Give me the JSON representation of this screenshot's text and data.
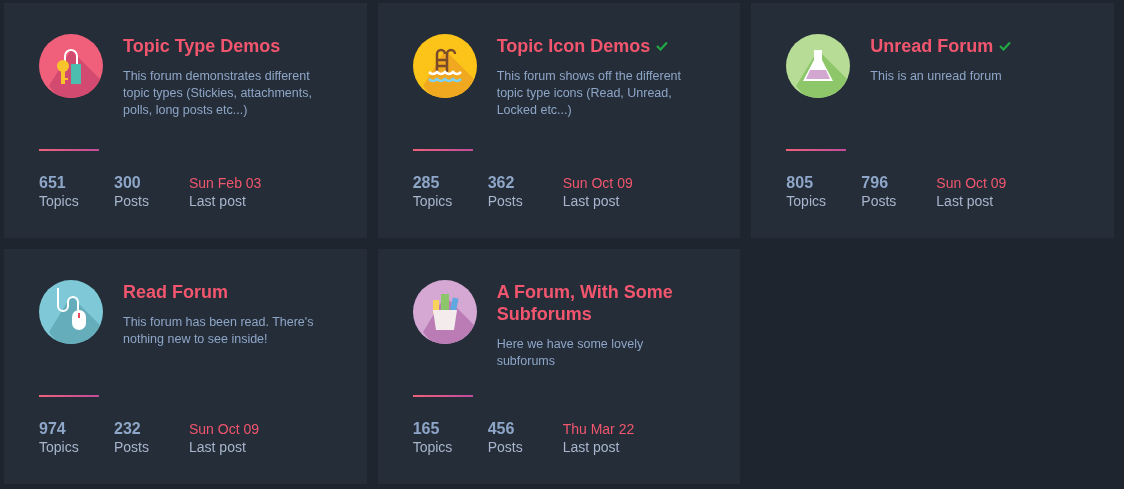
{
  "forums": [
    {
      "title": "Topic Type Demos",
      "checked": false,
      "description": "This forum demonstrates different topic types (Stickies, attachments, polls, long posts etc...)",
      "stats": [
        {
          "value": "651",
          "label": "Topics"
        },
        {
          "value": "300",
          "label": "Posts"
        }
      ],
      "last_post": {
        "value": "Sun Feb 03",
        "label": "Last post"
      }
    },
    {
      "title": "Topic Icon Demos",
      "checked": true,
      "description": "This forum shows off the different topic type icons (Read, Unread, Locked etc...)",
      "stats": [
        {
          "value": "285",
          "label": "Topics"
        },
        {
          "value": "362",
          "label": "Posts"
        }
      ],
      "last_post": {
        "value": "Sun Oct 09",
        "label": "Last post"
      }
    },
    {
      "title": "Unread Forum",
      "checked": true,
      "description": "This is an unread forum",
      "stats": [
        {
          "value": "805",
          "label": "Topics"
        },
        {
          "value": "796",
          "label": "Posts"
        }
      ],
      "last_post": {
        "value": "Sun Oct 09",
        "label": "Last post"
      }
    },
    {
      "title": "Read Forum",
      "checked": false,
      "description": "This forum has been read. There's nothing new to see inside!",
      "stats": [
        {
          "value": "974",
          "label": "Topics"
        },
        {
          "value": "232",
          "label": "Posts"
        }
      ],
      "last_post": {
        "value": "Sun Oct 09",
        "label": "Last post"
      }
    },
    {
      "title": "A Forum, With Some Subforums",
      "checked": false,
      "description": "Here we have some lovely subforums",
      "stats": [
        {
          "value": "165",
          "label": "Topics"
        },
        {
          "value": "456",
          "label": "Posts"
        }
      ],
      "last_post": {
        "value": "Thu Mar 22",
        "label": "Last post"
      }
    }
  ]
}
